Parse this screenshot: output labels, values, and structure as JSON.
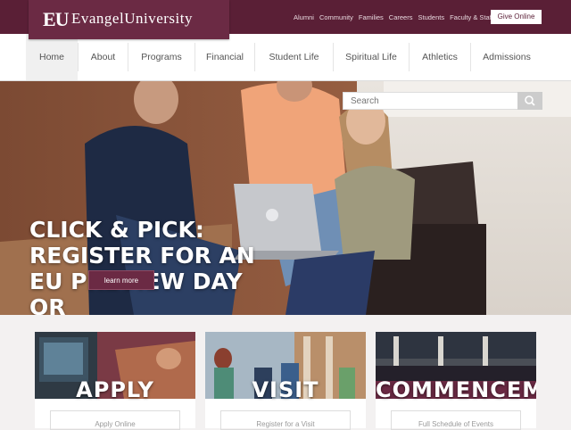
{
  "header": {
    "logo_mark": "EU",
    "logo_text": "EvangelUniversity",
    "top_links": [
      "Alumni",
      "Community",
      "Families",
      "Careers",
      "Students",
      "Faculty & Staff"
    ],
    "give_button": "Give Online"
  },
  "nav": {
    "items": [
      "Home",
      "About",
      "Programs",
      "Financial",
      "Student Life",
      "Spiritual Life",
      "Athletics",
      "Admissions"
    ],
    "active": "Home"
  },
  "hero": {
    "search_placeholder": "Search",
    "headline": "Click & Pick: Register for an EU Preview Day or Personalized Visit",
    "button": "learn more"
  },
  "cards": [
    {
      "title": "APPLY",
      "link": "Apply Online"
    },
    {
      "title": "VISIT",
      "link": "Register for a Visit"
    },
    {
      "title": "COMMENCEM",
      "link": "Full Schedule of Events"
    }
  ],
  "colors": {
    "brand": "#5a1f36",
    "brand_light": "#6b2a44"
  }
}
